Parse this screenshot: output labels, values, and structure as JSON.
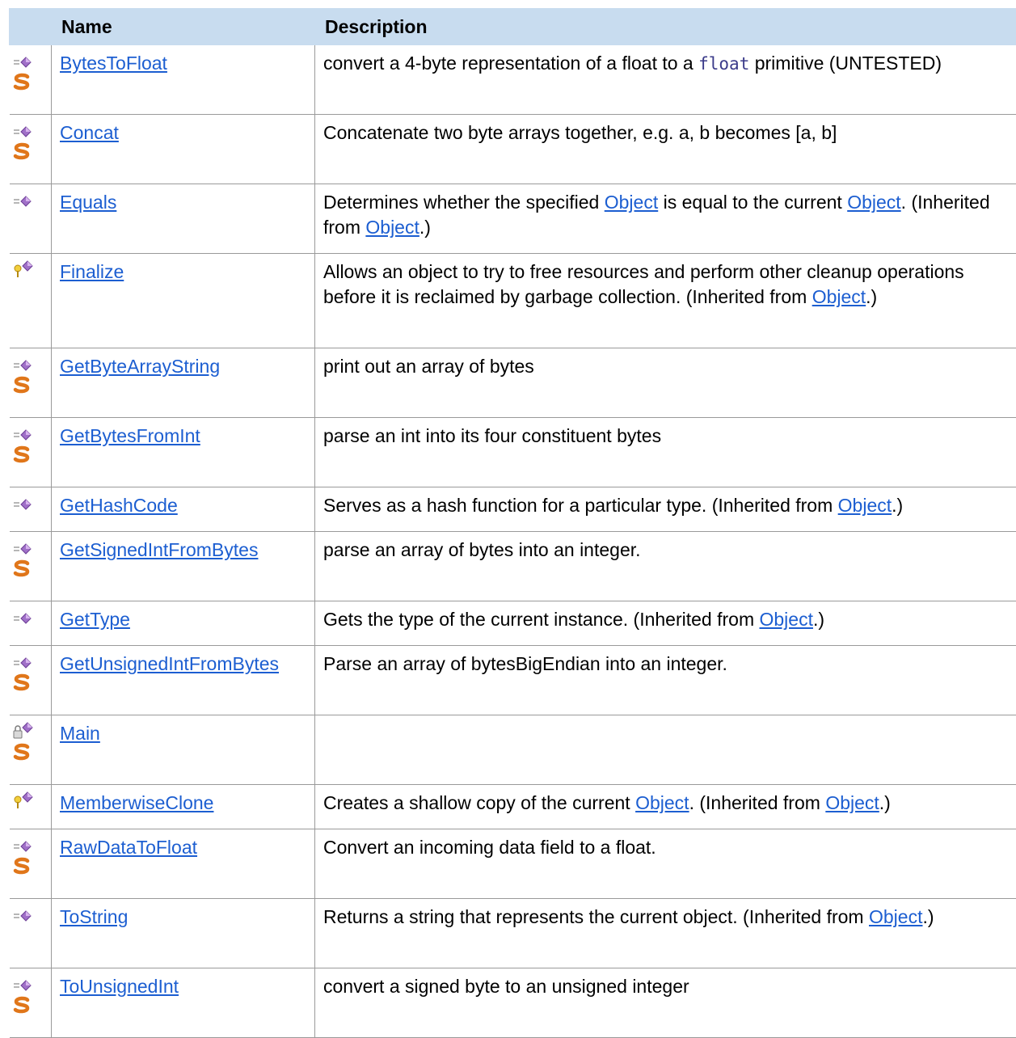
{
  "header": {
    "name": "Name",
    "description": "Description"
  },
  "rows": [
    {
      "name": "BytesToFloat",
      "icon": "public-method-icon",
      "static": true,
      "desc": [
        {
          "t": "text",
          "v": "convert a 4-byte representation of a float to a "
        },
        {
          "t": "code",
          "v": "float"
        },
        {
          "t": "text",
          "v": " primitive (UNTESTED)"
        }
      ]
    },
    {
      "name": "Concat",
      "icon": "public-method-icon",
      "static": true,
      "desc": [
        {
          "t": "text",
          "v": "Concatenate two byte arrays together, e.g. a, b becomes [a, b]"
        }
      ]
    },
    {
      "name": "Equals",
      "icon": "public-method-icon",
      "static": false,
      "desc": [
        {
          "t": "text",
          "v": "Determines whether the specified "
        },
        {
          "t": "link",
          "v": "Object"
        },
        {
          "t": "text",
          "v": " is equal to the current "
        },
        {
          "t": "link",
          "v": "Object"
        },
        {
          "t": "text",
          "v": ". (Inherited from "
        },
        {
          "t": "link",
          "v": "Object"
        },
        {
          "t": "text",
          "v": ".)"
        }
      ]
    },
    {
      "name": "Finalize",
      "icon": "protected-method-icon",
      "static": false,
      "desc": [
        {
          "t": "text",
          "v": "Allows an object to try to free resources and perform other cleanup operations before it is reclaimed by garbage collection. (Inherited from "
        },
        {
          "t": "link",
          "v": "Object"
        },
        {
          "t": "text",
          "v": ".)"
        }
      ]
    },
    {
      "name": "GetByteArrayString",
      "icon": "public-method-icon",
      "static": true,
      "desc": [
        {
          "t": "text",
          "v": "print out an array of bytes"
        }
      ]
    },
    {
      "name": "GetBytesFromInt",
      "icon": "public-method-icon",
      "static": true,
      "desc": [
        {
          "t": "text",
          "v": "parse an int into its four constituent bytes"
        }
      ]
    },
    {
      "name": "GetHashCode",
      "icon": "public-method-icon",
      "static": false,
      "desc": [
        {
          "t": "text",
          "v": "Serves as a hash function for a particular type. (Inherited from "
        },
        {
          "t": "link",
          "v": "Object"
        },
        {
          "t": "text",
          "v": ".)"
        }
      ]
    },
    {
      "name": "GetSignedIntFromBytes",
      "icon": "public-method-icon",
      "static": true,
      "desc": [
        {
          "t": "text",
          "v": "parse an array of bytes into an integer."
        }
      ]
    },
    {
      "name": "GetType",
      "icon": "public-method-icon",
      "static": false,
      "desc": [
        {
          "t": "text",
          "v": "Gets the type of the current instance. (Inherited from "
        },
        {
          "t": "link",
          "v": "Object"
        },
        {
          "t": "text",
          "v": ".)"
        }
      ]
    },
    {
      "name": "GetUnsignedIntFromBytes",
      "icon": "public-method-icon",
      "static": true,
      "desc": [
        {
          "t": "text",
          "v": "Parse an array of bytesBigEndian into an integer."
        }
      ]
    },
    {
      "name": "Main",
      "icon": "private-method-icon",
      "static": true,
      "desc": []
    },
    {
      "name": "MemberwiseClone",
      "icon": "protected-method-icon",
      "static": false,
      "desc": [
        {
          "t": "text",
          "v": "Creates a shallow copy of the current "
        },
        {
          "t": "link",
          "v": "Object"
        },
        {
          "t": "text",
          "v": ". (Inherited from "
        },
        {
          "t": "link",
          "v": "Object"
        },
        {
          "t": "text",
          "v": ".)"
        }
      ]
    },
    {
      "name": "RawDataToFloat",
      "icon": "public-method-icon",
      "static": true,
      "desc": [
        {
          "t": "text",
          "v": "Convert an incoming data field to a float."
        }
      ]
    },
    {
      "name": "ToString",
      "icon": "public-method-icon",
      "static": false,
      "desc": [
        {
          "t": "text",
          "v": "Returns a string that represents the current object. (Inherited from "
        },
        {
          "t": "link",
          "v": "Object"
        },
        {
          "t": "text",
          "v": ".)"
        }
      ]
    },
    {
      "name": "ToUnsignedInt",
      "icon": "public-method-icon",
      "static": true,
      "desc": [
        {
          "t": "text",
          "v": "convert a signed byte to an unsigned integer"
        }
      ]
    }
  ],
  "colors": {
    "header_bg": "#c8dcef",
    "link": "#1c5ed1",
    "border": "#9a9a9a",
    "method_purple": "#a070c8",
    "static_orange": "#e0761a"
  }
}
